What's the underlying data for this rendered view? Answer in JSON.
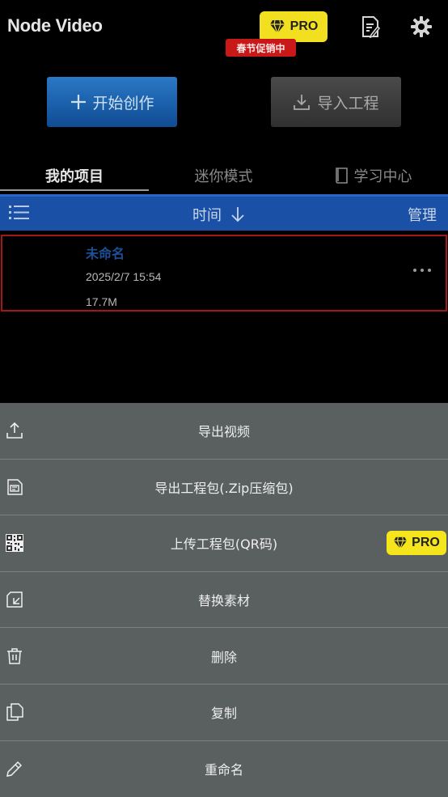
{
  "header": {
    "app_title": "Node Video",
    "pro_label": "PRO",
    "promo_label": "春节促销中",
    "icons": [
      "document-edit-icon",
      "gear-icon"
    ]
  },
  "actions": {
    "create_label": "开始创作",
    "import_label": "导入工程"
  },
  "tabs": [
    {
      "label": "我的项目",
      "active": true
    },
    {
      "label": "迷你模式",
      "active": false
    },
    {
      "label": "学习中心",
      "active": false
    }
  ],
  "sort_bar": {
    "sort_label": "时间",
    "manage_label": "管理"
  },
  "project": {
    "name": "未命名",
    "date": "2025/2/7 15:54",
    "size": "17.7M"
  },
  "menu": {
    "items": [
      {
        "label": "导出视频",
        "icon": "upload-icon"
      },
      {
        "label": "导出工程包(.Zip压缩包)",
        "icon": "archive-icon"
      },
      {
        "label": "上传工程包(QR码)",
        "icon": "qr-code-icon",
        "pro": "PRO"
      },
      {
        "label": "替换素材",
        "icon": "replace-icon"
      },
      {
        "label": "删除",
        "icon": "trash-icon"
      },
      {
        "label": "复制",
        "icon": "copy-icon"
      },
      {
        "label": "重命名",
        "icon": "pencil-icon"
      }
    ]
  },
  "colors": {
    "accent_blue": "#1a50a6",
    "pro_yellow": "#f2e020",
    "promo_red": "#c81818",
    "sheet_bg": "#5a5f5f"
  }
}
